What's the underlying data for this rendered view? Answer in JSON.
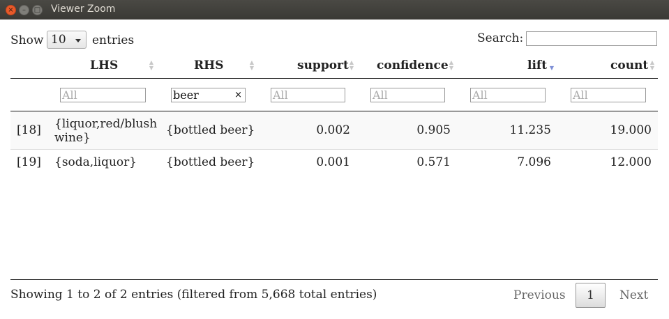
{
  "window": {
    "title": "Viewer Zoom",
    "close_glyph": "×",
    "minimize_glyph": "–",
    "maximize_glyph": "□"
  },
  "length_control": {
    "show_label": "Show",
    "value": "10",
    "entries_label": "entries"
  },
  "search": {
    "label": "Search:",
    "value": ""
  },
  "columns": [
    {
      "label": "LHS",
      "sort": "none"
    },
    {
      "label": "RHS",
      "sort": "none"
    },
    {
      "label": "support",
      "sort": "none"
    },
    {
      "label": "confidence",
      "sort": "none"
    },
    {
      "label": "lift",
      "sort": "descending"
    },
    {
      "label": "count",
      "sort": "none"
    }
  ],
  "filters": {
    "placeholder": "All",
    "rhs_value": "beer",
    "clear_glyph": "×"
  },
  "rows": [
    {
      "index": "[18]",
      "lhs": "{liquor,red/blush wine}",
      "rhs": "{bottled beer}",
      "support": "0.002",
      "confidence": "0.905",
      "lift": "11.235",
      "count": "19.000"
    },
    {
      "index": "[19]",
      "lhs": "{soda,liquor}",
      "rhs": "{bottled beer}",
      "support": "0.001",
      "confidence": "0.571",
      "lift": "7.096",
      "count": "12.000"
    }
  ],
  "footer": {
    "info": "Showing 1 to 2 of 2 entries (filtered from 5,668 total entries)",
    "previous": "Previous",
    "current_page": "1",
    "next": "Next"
  },
  "colors": {
    "titlebar": "#3c3b37",
    "close_button": "#e85a2a",
    "sort_active": "#7d8fd6"
  }
}
